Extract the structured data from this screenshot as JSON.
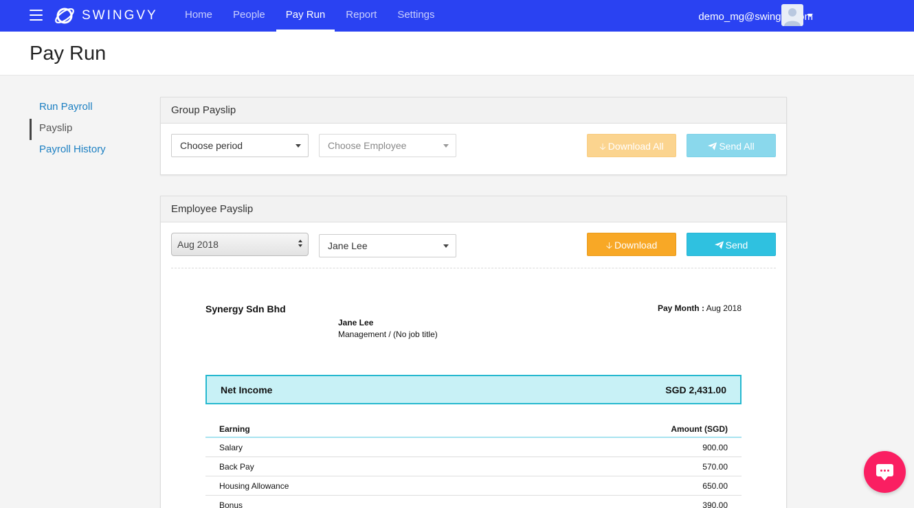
{
  "app": {
    "brand": "SWINGVY",
    "nav": [
      "Home",
      "People",
      "Pay Run",
      "Report",
      "Settings"
    ],
    "active_nav": "Pay Run",
    "user_email": "demo_mg@swingvy.com"
  },
  "page": {
    "title": "Pay Run"
  },
  "sidebar": {
    "items": [
      {
        "label": "Run Payroll"
      },
      {
        "label": "Payslip"
      },
      {
        "label": "Payroll History"
      }
    ]
  },
  "group_payslip": {
    "title": "Group Payslip",
    "period_select": "Choose period",
    "employee_select": "Choose Employee",
    "download_all": "Download All",
    "send_all": "Send All"
  },
  "employee_payslip": {
    "title": "Employee Payslip",
    "month_select": "Aug 2018",
    "employee_select": "Jane Lee",
    "download": "Download",
    "send": "Send"
  },
  "payslip": {
    "company": "Synergy Sdn Bhd",
    "pay_month_label": "Pay Month :",
    "pay_month_value": "Aug 2018",
    "employee_name": "Jane Lee",
    "employee_dept": "Management / (No job title)",
    "net_income_label": "Net Income",
    "net_income_value": "SGD 2,431.00",
    "earnings_header": [
      "Earning",
      "Amount (SGD)"
    ],
    "earnings": [
      {
        "name": "Salary",
        "amount": "900.00"
      },
      {
        "name": "Back Pay",
        "amount": "570.00"
      },
      {
        "name": "Housing Allowance",
        "amount": "650.00"
      },
      {
        "name": "Bonus",
        "amount": "390.00"
      }
    ]
  },
  "colors": {
    "navbar": "#2a42f2",
    "accent_orange": "#f8a826",
    "accent_cyan": "#2fc1e0",
    "chat_button": "#fa1f62",
    "link_blue": "#1b7fc2"
  },
  "icons": [
    "menu-icon",
    "swingvy-logo",
    "user-avatar-icon",
    "caret-down-icon",
    "download-icon",
    "paper-plane-icon",
    "chat-icon"
  ]
}
